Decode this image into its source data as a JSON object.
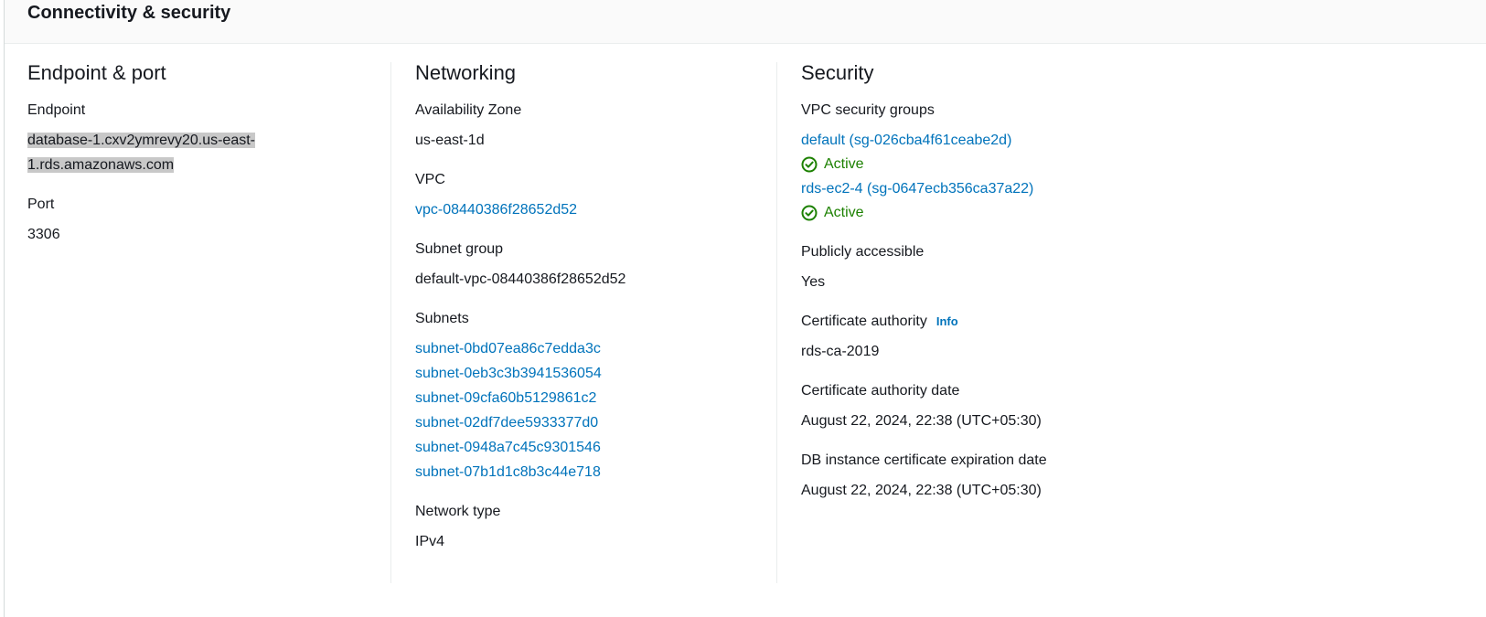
{
  "panel": {
    "title": "Connectivity & security"
  },
  "endpoint_port": {
    "heading": "Endpoint & port",
    "endpoint_label": "Endpoint",
    "endpoint_line1": "database-1.cxv2ymrevy20.us-east-",
    "endpoint_line2": "1.rds.amazonaws.com",
    "port_label": "Port",
    "port_value": "3306"
  },
  "networking": {
    "heading": "Networking",
    "az_label": "Availability Zone",
    "az_value": "us-east-1d",
    "vpc_label": "VPC",
    "vpc_value": "vpc-08440386f28652d52",
    "subnet_group_label": "Subnet group",
    "subnet_group_value": "default-vpc-08440386f28652d52",
    "subnets_label": "Subnets",
    "subnets": [
      "subnet-0bd07ea86c7edda3c",
      "subnet-0eb3c3b3941536054",
      "subnet-09cfa60b5129861c2",
      "subnet-02df7dee5933377d0",
      "subnet-0948a7c45c9301546",
      "subnet-07b1d1c8b3c44e718"
    ],
    "network_type_label": "Network type",
    "network_type_value": "IPv4"
  },
  "security": {
    "heading": "Security",
    "vpc_sg_label": "VPC security groups",
    "security_groups": [
      {
        "name": "default (sg-026cba4f61ceabe2d)",
        "status": "Active"
      },
      {
        "name": "rds-ec2-4 (sg-0647ecb356ca37a22)",
        "status": "Active"
      }
    ],
    "public_label": "Publicly accessible",
    "public_value": "Yes",
    "ca_label": "Certificate authority",
    "ca_info": "Info",
    "ca_value": "rds-ca-2019",
    "ca_date_label": "Certificate authority date",
    "ca_date_value": "August 22, 2024, 22:38 (UTC+05:30)",
    "cert_exp_label": "DB instance certificate expiration date",
    "cert_exp_value": "August 22, 2024, 22:38 (UTC+05:30)"
  },
  "colors": {
    "link": "#0073bb",
    "status_success": "#1d8102",
    "highlight": "#c8c8c8"
  },
  "icons": {
    "status": "status-positive-icon"
  }
}
